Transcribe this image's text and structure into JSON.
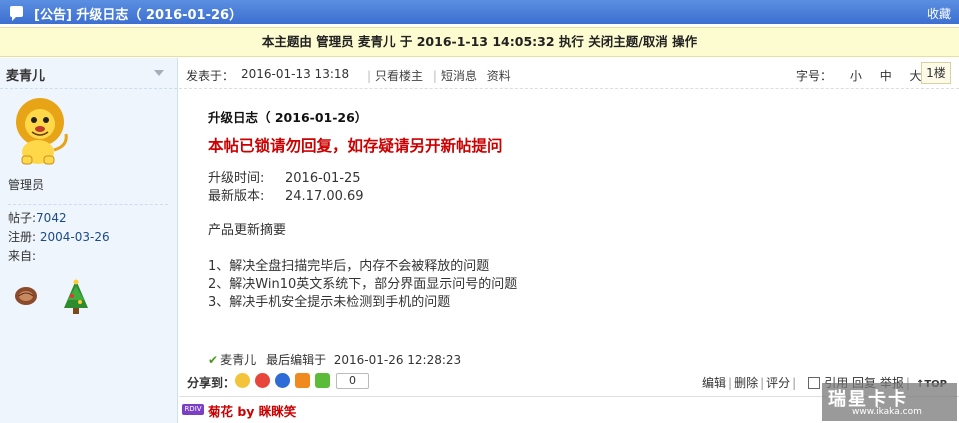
{
  "titlebar": {
    "title": "[公告] 升级日志（ 2016-01-26）",
    "favorite": "收藏"
  },
  "modbar": {
    "text": "本主题由 管理员 麦青儿 于 2016-1-13 14:05:32 执行 关闭主题/取消 操作"
  },
  "user": {
    "name": "麦青儿",
    "role": "管理员",
    "posts_label": "帖子:",
    "posts_value": "7042",
    "reg_label": "注册:",
    "reg_value": "2004-03-26",
    "from_label": "来自:"
  },
  "post": {
    "posted_label": "发表于：",
    "posted_date": "2016-01-13 13:18",
    "only_author": "只看楼主",
    "short_msg": "短消息",
    "profile": "资料",
    "fontsize_label": "字号：",
    "font_small": "小",
    "font_medium": "中",
    "font_large": "大",
    "floor": "1楼",
    "title": "升级日志（ 2016-01-26）",
    "locked_notice": "本帖已锁请勿回复，如存疑请另开新帖提问",
    "upgrade_time_label": "升级时间:",
    "upgrade_time_value": "2016-01-25",
    "latest_version_label": "最新版本:",
    "latest_version_value": "24.17.00.69",
    "summary_heading": "产品更新摘要",
    "items": [
      "1、解决全盘扫描完毕后，内存不会被释放的问题",
      "2、解决Win10英文系统下，部分界面显示问号的问题",
      "3、解决手机安全提示未检测到手机的问题"
    ],
    "edit_user": "麦青儿",
    "edit_label": "最后编辑于",
    "edit_time": "2016-01-26 12:28:23"
  },
  "share": {
    "label": "分享到：",
    "count": "0"
  },
  "actions": {
    "edit": "编辑",
    "delete": "删除",
    "rate": "评分",
    "quote": "引用",
    "reply": "回复",
    "report": "举报",
    "top": "TOP"
  },
  "signature": {
    "tag": "RDIV",
    "text": "菊花 by 眯眯笑"
  },
  "watermark": {
    "line1": "瑞星卡卡",
    "line2": "www.ikaka.com"
  }
}
